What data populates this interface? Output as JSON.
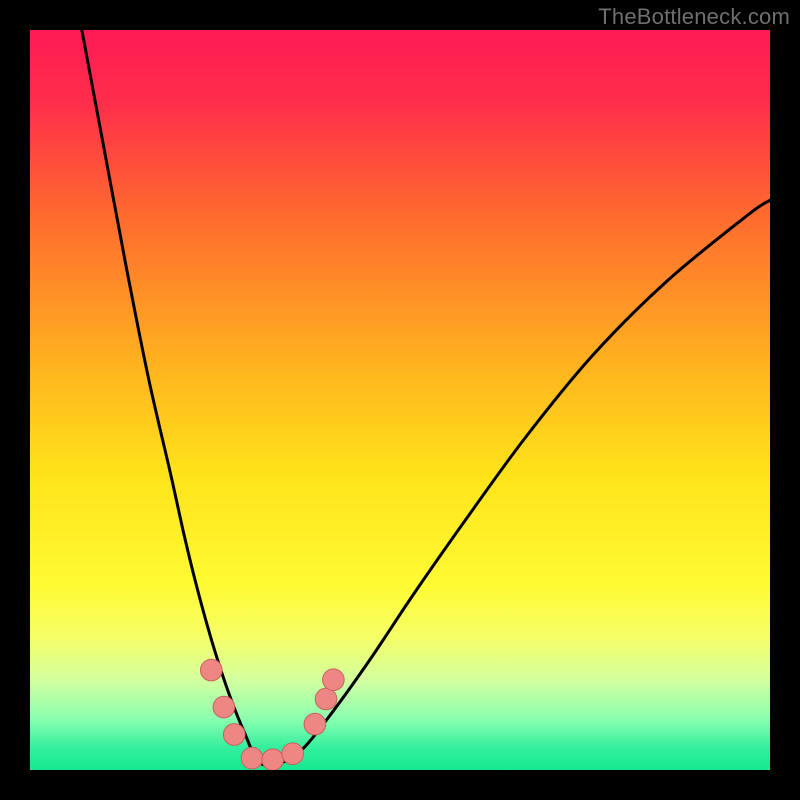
{
  "watermark": "TheBottleneck.com",
  "colors": {
    "frame": "#000000",
    "gradient_stops": [
      {
        "offset": "0%",
        "color": "#ff1a55"
      },
      {
        "offset": "10%",
        "color": "#ff2e4a"
      },
      {
        "offset": "25%",
        "color": "#ff6a2f"
      },
      {
        "offset": "45%",
        "color": "#ffb21f"
      },
      {
        "offset": "60%",
        "color": "#ffe31a"
      },
      {
        "offset": "75%",
        "color": "#fffb33"
      },
      {
        "offset": "82%",
        "color": "#f6ff66"
      },
      {
        "offset": "88%",
        "color": "#d2ffa0"
      },
      {
        "offset": "93%",
        "color": "#8cffb0"
      },
      {
        "offset": "97%",
        "color": "#33ef9e"
      },
      {
        "offset": "100%",
        "color": "#15e98f"
      }
    ],
    "curve": "#000000",
    "marker_fill": "#ee8683",
    "marker_stroke": "#c9615f"
  },
  "chart_data": {
    "type": "line",
    "title": "",
    "xlabel": "",
    "ylabel": "",
    "xlim": [
      0,
      100
    ],
    "ylim": [
      0,
      100
    ],
    "note": "Heat background: vertical gradient from red (top, high bottleneck) to green (bottom, zero bottleneck). Curve shows bottleneck percentage vs relative component performance; minimum near x≈31 where curve touches y≈0.",
    "series": [
      {
        "name": "bottleneck-curve",
        "x": [
          7,
          10,
          13,
          16,
          19,
          21,
          23,
          25,
          27,
          29,
          31,
          34,
          37,
          41,
          46,
          52,
          59,
          67,
          76,
          86,
          97,
          100
        ],
        "y": [
          100,
          84,
          68,
          53,
          40,
          31,
          23,
          16,
          10,
          5,
          1,
          1,
          3,
          8,
          15,
          24,
          34,
          45,
          56,
          66,
          75,
          77
        ]
      }
    ],
    "markers": [
      {
        "x": 24.5,
        "y": 13.5,
        "r": 1.3
      },
      {
        "x": 26.2,
        "y": 8.5,
        "r": 1.3
      },
      {
        "x": 27.6,
        "y": 4.8,
        "r": 1.3
      },
      {
        "x": 30.0,
        "y": 1.6,
        "r": 1.3
      },
      {
        "x": 32.8,
        "y": 1.4,
        "r": 1.3
      },
      {
        "x": 35.5,
        "y": 2.2,
        "r": 1.3
      },
      {
        "x": 38.5,
        "y": 6.2,
        "r": 1.3
      },
      {
        "x": 40.0,
        "y": 9.6,
        "r": 1.3
      },
      {
        "x": 41.0,
        "y": 12.2,
        "r": 1.3
      }
    ]
  }
}
